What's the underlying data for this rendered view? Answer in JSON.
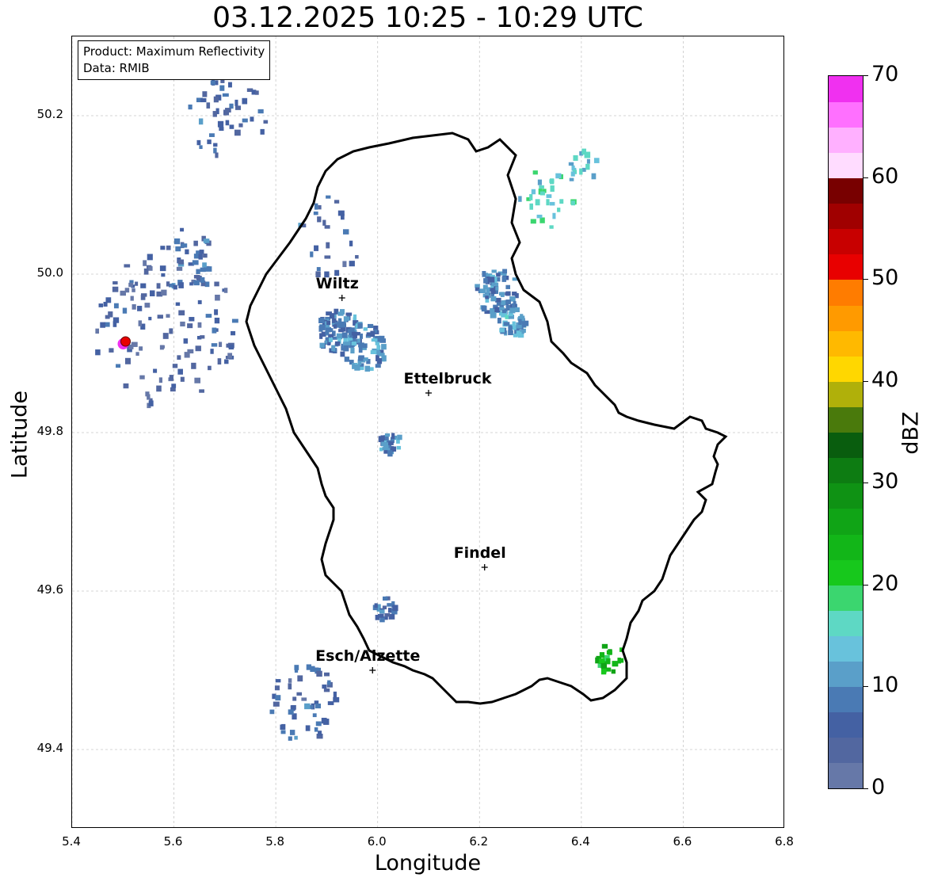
{
  "title": "03.12.2025 10:25 - 10:29 UTC",
  "info": {
    "product": "Product: Maximum Reflectivity",
    "data": "Data: RMIB"
  },
  "axes": {
    "xlabel": "Longitude",
    "ylabel": "Latitude",
    "xlim": [
      5.4,
      6.8
    ],
    "ylim": [
      49.3,
      50.3
    ],
    "xticks": [
      "5.4",
      "5.6",
      "5.8",
      "6.0",
      "6.2",
      "6.4",
      "6.6",
      "6.8"
    ],
    "yticks": [
      "49.4",
      "49.6",
      "49.8",
      "50.0",
      "50.2"
    ],
    "grid": true
  },
  "colorbar": {
    "label": "dBZ",
    "ticks": [
      "0",
      "10",
      "20",
      "30",
      "40",
      "50",
      "60",
      "70"
    ],
    "range": [
      0,
      70
    ],
    "colors": [
      "#6678a8",
      "#5267a0",
      "#4461a3",
      "#4a7ab4",
      "#5a9fc9",
      "#68c2dc",
      "#5ed8c4",
      "#3bd66f",
      "#17c81c",
      "#12b618",
      "#10a416",
      "#0f9214",
      "#0d7c12",
      "#095d0e",
      "#4a7a0c",
      "#b0b00a",
      "#ffd700",
      "#ffb900",
      "#ff9a00",
      "#ff7c00",
      "#e80000",
      "#c80000",
      "#a00000",
      "#780000",
      "#ffdcff",
      "#ffb0ff",
      "#ff70ff",
      "#f030f0"
    ]
  },
  "cities": [
    {
      "name": "Wiltz",
      "lon": 5.93,
      "lat": 49.97
    },
    {
      "name": "Ettelbruck",
      "lon": 6.1,
      "lat": 49.85
    },
    {
      "name": "Findel",
      "lon": 6.21,
      "lat": 49.63
    },
    {
      "name": "Esch/Alzette",
      "lon": 5.99,
      "lat": 49.5
    }
  ],
  "radar_site": {
    "lon": 5.505,
    "lat": 49.915
  },
  "echo_clusters": [
    {
      "lon": 5.92,
      "lat": 49.93,
      "count": 90,
      "spread": 0.03,
      "dbz": 8
    },
    {
      "lon": 5.97,
      "lat": 49.91,
      "count": 60,
      "spread": 0.03,
      "dbz": 9
    },
    {
      "lon": 6.23,
      "lat": 49.98,
      "count": 80,
      "spread": 0.03,
      "dbz": 8
    },
    {
      "lon": 6.26,
      "lat": 49.94,
      "count": 40,
      "spread": 0.02,
      "dbz": 10
    },
    {
      "lon": 6.02,
      "lat": 49.79,
      "count": 30,
      "spread": 0.015,
      "dbz": 8
    },
    {
      "lon": 5.58,
      "lat": 49.93,
      "count": 120,
      "spread": 0.1,
      "dbz": 3
    },
    {
      "lon": 5.62,
      "lat": 50.02,
      "count": 40,
      "spread": 0.04,
      "dbz": 6
    },
    {
      "lon": 5.7,
      "lat": 50.21,
      "count": 50,
      "spread": 0.06,
      "dbz": 5
    },
    {
      "lon": 5.85,
      "lat": 49.46,
      "count": 50,
      "spread": 0.05,
      "dbz": 5
    },
    {
      "lon": 6.01,
      "lat": 49.58,
      "count": 20,
      "spread": 0.015,
      "dbz": 6
    },
    {
      "lon": 6.33,
      "lat": 50.1,
      "count": 30,
      "spread": 0.04,
      "dbz": 14
    },
    {
      "lon": 6.45,
      "lat": 49.52,
      "count": 20,
      "spread": 0.02,
      "dbz": 22
    },
    {
      "lon": 5.9,
      "lat": 50.05,
      "count": 25,
      "spread": 0.05,
      "dbz": 5
    },
    {
      "lon": 6.4,
      "lat": 50.14,
      "count": 15,
      "spread": 0.02,
      "dbz": 12
    }
  ]
}
